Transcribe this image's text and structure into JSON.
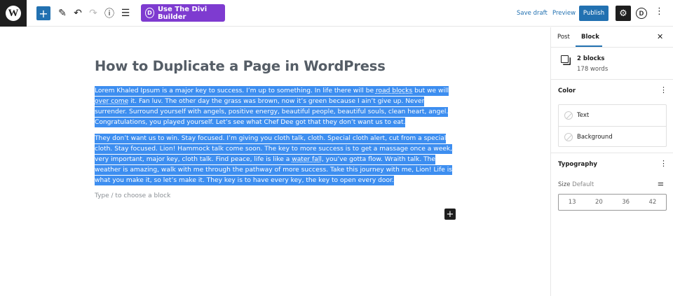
{
  "topbar": {
    "logo": "W",
    "divi_label": "Use The Divi Builder",
    "divi_badge": "D",
    "save_draft": "Save draft",
    "preview": "Preview",
    "publish": "Publish",
    "plugin_badge": "D"
  },
  "editor": {
    "title": "How to Duplicate a Page in WordPress",
    "paragraph1": {
      "before1": "Lorem Khaled Ipsum is a major key to success. I’m up to something. In life there will be ",
      "link1": "road blocks",
      "mid": " but we will ",
      "link2": "over come",
      "after": " it. Fan luv. The other day the grass was brown, now it’s green because I ain’t give up. Never surrender. Surround yourself with angels, positive energy, beautiful people, beautiful souls, clean heart, angel. Congratulations, you played yourself. Let’s see what Chef Dee got that they don’t want us to eat."
    },
    "paragraph2": {
      "before": "They don’t want us to win. Stay focused. I’m giving you cloth talk, cloth. Special cloth alert, cut from a special cloth. Stay focused. Lion! Hammock talk come soon. The key to more success is to get a massage once a week, very important, major key, cloth talk. Find peace, life is like a ",
      "link": "water fall",
      "after": ", you’ve gotta flow. Wraith talk. The weather is amazing, walk with me through the pathway of more success. Take this journey with me, Lion! Life is what you make it, so let’s make it. They key is to have every key, the key to open every door."
    },
    "placeholder": "Type / to choose a block"
  },
  "sidebar": {
    "tabs": [
      "Post",
      "Block"
    ],
    "active_tab": "Block",
    "block_count": "2 blocks",
    "word_count": "178 words",
    "color": {
      "heading": "Color",
      "options": [
        "Text",
        "Background"
      ]
    },
    "typography": {
      "heading": "Typography",
      "size_label": "Size",
      "size_value": "Default",
      "sizes": [
        "13",
        "20",
        "36",
        "42"
      ]
    }
  },
  "colors": {
    "accent": "#2271b1",
    "divi": "#7e3bd0",
    "selection": "#3d8ef0"
  }
}
